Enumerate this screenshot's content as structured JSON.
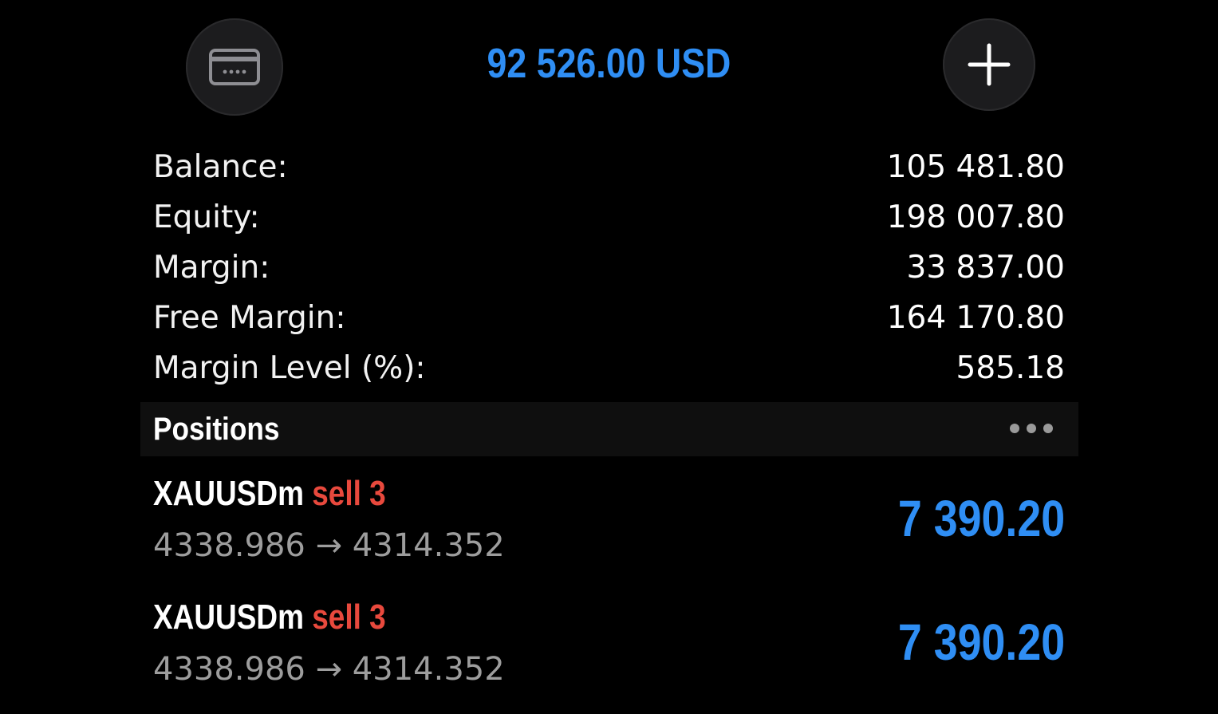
{
  "header": {
    "total_equity_display": "92 526.00 USD",
    "left_button_icon": "credit-card-icon",
    "right_button_icon": "plus-icon"
  },
  "summary": {
    "rows": [
      {
        "label": "Balance:",
        "value": "105 481.80"
      },
      {
        "label": "Equity:",
        "value": "198 007.80"
      },
      {
        "label": "Margin:",
        "value": "33 837.00"
      },
      {
        "label": "Free Margin:",
        "value": "164 170.80"
      },
      {
        "label": "Margin Level (%):",
        "value": "585.18"
      }
    ]
  },
  "positions": {
    "title": "Positions",
    "menu_icon": "more-dots-icon",
    "items": [
      {
        "symbol": "XAUUSDm",
        "side": "sell 3",
        "prices": "4338.986 → 4314.352",
        "profit": "7 390.20"
      },
      {
        "symbol": "XAUUSDm",
        "side": "sell 3",
        "prices": "4338.986 → 4314.352",
        "profit": "7 390.20"
      }
    ]
  },
  "colors": {
    "accent_blue": "#2f8ef4",
    "sell_red": "#e8493d",
    "background": "#000000"
  }
}
